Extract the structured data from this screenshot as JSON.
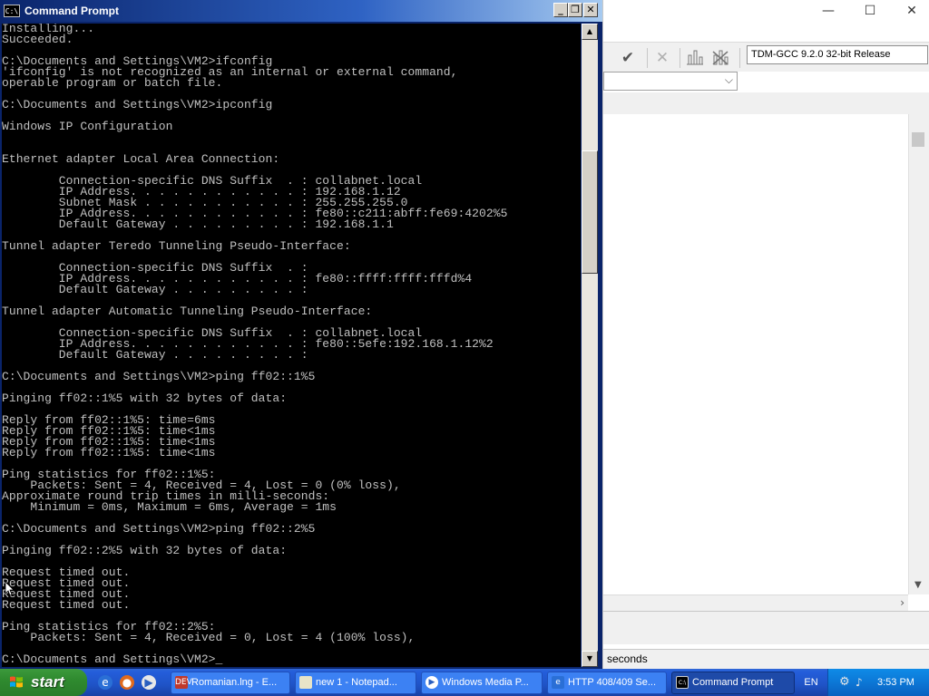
{
  "cmd": {
    "title": "Command Prompt",
    "icon_text": "C:\\",
    "icon": "cmd-icon",
    "lines": [
      "Installing...",
      "Succeeded.",
      "",
      "C:\\Documents and Settings\\VM2>ifconfig",
      "'ifconfig' is not recognized as an internal or external command,",
      "operable program or batch file.",
      "",
      "C:\\Documents and Settings\\VM2>ipconfig",
      "",
      "Windows IP Configuration",
      "",
      "",
      "Ethernet adapter Local Area Connection:",
      "",
      "        Connection-specific DNS Suffix  . : collabnet.local",
      "        IP Address. . . . . . . . . . . . : 192.168.1.12",
      "        Subnet Mask . . . . . . . . . . . : 255.255.255.0",
      "        IP Address. . . . . . . . . . . . : fe80::c211:abff:fe69:4202%5",
      "        Default Gateway . . . . . . . . . : 192.168.1.1",
      "",
      "Tunnel adapter Teredo Tunneling Pseudo-Interface:",
      "",
      "        Connection-specific DNS Suffix  . :",
      "        IP Address. . . . . . . . . . . . : fe80::ffff:ffff:fffd%4",
      "        Default Gateway . . . . . . . . . :",
      "",
      "Tunnel adapter Automatic Tunneling Pseudo-Interface:",
      "",
      "        Connection-specific DNS Suffix  . : collabnet.local",
      "        IP Address. . . . . . . . . . . . : fe80::5efe:192.168.1.12%2",
      "        Default Gateway . . . . . . . . . :",
      "",
      "C:\\Documents and Settings\\VM2>ping ff02::1%5",
      "",
      "Pinging ff02::1%5 with 32 bytes of data:",
      "",
      "Reply from ff02::1%5: time=6ms",
      "Reply from ff02::1%5: time<1ms",
      "Reply from ff02::1%5: time<1ms",
      "Reply from ff02::1%5: time<1ms",
      "",
      "Ping statistics for ff02::1%5:",
      "    Packets: Sent = 4, Received = 4, Lost = 0 (0% loss),",
      "Approximate round trip times in milli-seconds:",
      "    Minimum = 0ms, Maximum = 6ms, Average = 1ms",
      "",
      "C:\\Documents and Settings\\VM2>ping ff02::2%5",
      "",
      "Pinging ff02::2%5 with 32 bytes of data:",
      "",
      "Request timed out.",
      "Request timed out.",
      "Request timed out.",
      "Request timed out.",
      "",
      "Ping statistics for ff02::2%5:",
      "    Packets: Sent = 4, Received = 0, Lost = 4 (100% loss),",
      "",
      "C:\\Documents and Settings\\VM2>_"
    ],
    "controls": {
      "minimize": "_",
      "restore": "❐",
      "close": "✕"
    },
    "scroll": {
      "up": "▲",
      "down": "▼"
    }
  },
  "ide": {
    "controls": {
      "minimize": "—",
      "maximize": "☐",
      "close": "✕"
    },
    "toolbar_icons": [
      "check-icon",
      "cross-icon",
      "chart-icon",
      "delete-chart-icon"
    ],
    "compiler": "TDM-GCC 9.2.0 32-bit Release",
    "status": "seconds"
  },
  "taskbar": {
    "start_label": "start",
    "quick_launch": [
      "ie-icon",
      "firefox-icon",
      "media-player-icon"
    ],
    "tasks": [
      {
        "label": "Romanian.lng - E...",
        "icon": "dev-icon",
        "icon_text": "DEV",
        "active": false
      },
      {
        "label": "new 1 - Notepad...",
        "icon": "notepad-icon",
        "icon_text": "",
        "active": false
      },
      {
        "label": "Windows Media P...",
        "icon": "media-player-icon",
        "icon_text": "",
        "active": false
      },
      {
        "label": "HTTP 408/409 Se...",
        "icon": "ie-icon",
        "icon_text": "",
        "active": false
      },
      {
        "label": "Command Prompt",
        "icon": "cmd-icon",
        "icon_text": "C:\\",
        "active": true
      }
    ],
    "language": "EN",
    "clock": "3:53 PM"
  }
}
